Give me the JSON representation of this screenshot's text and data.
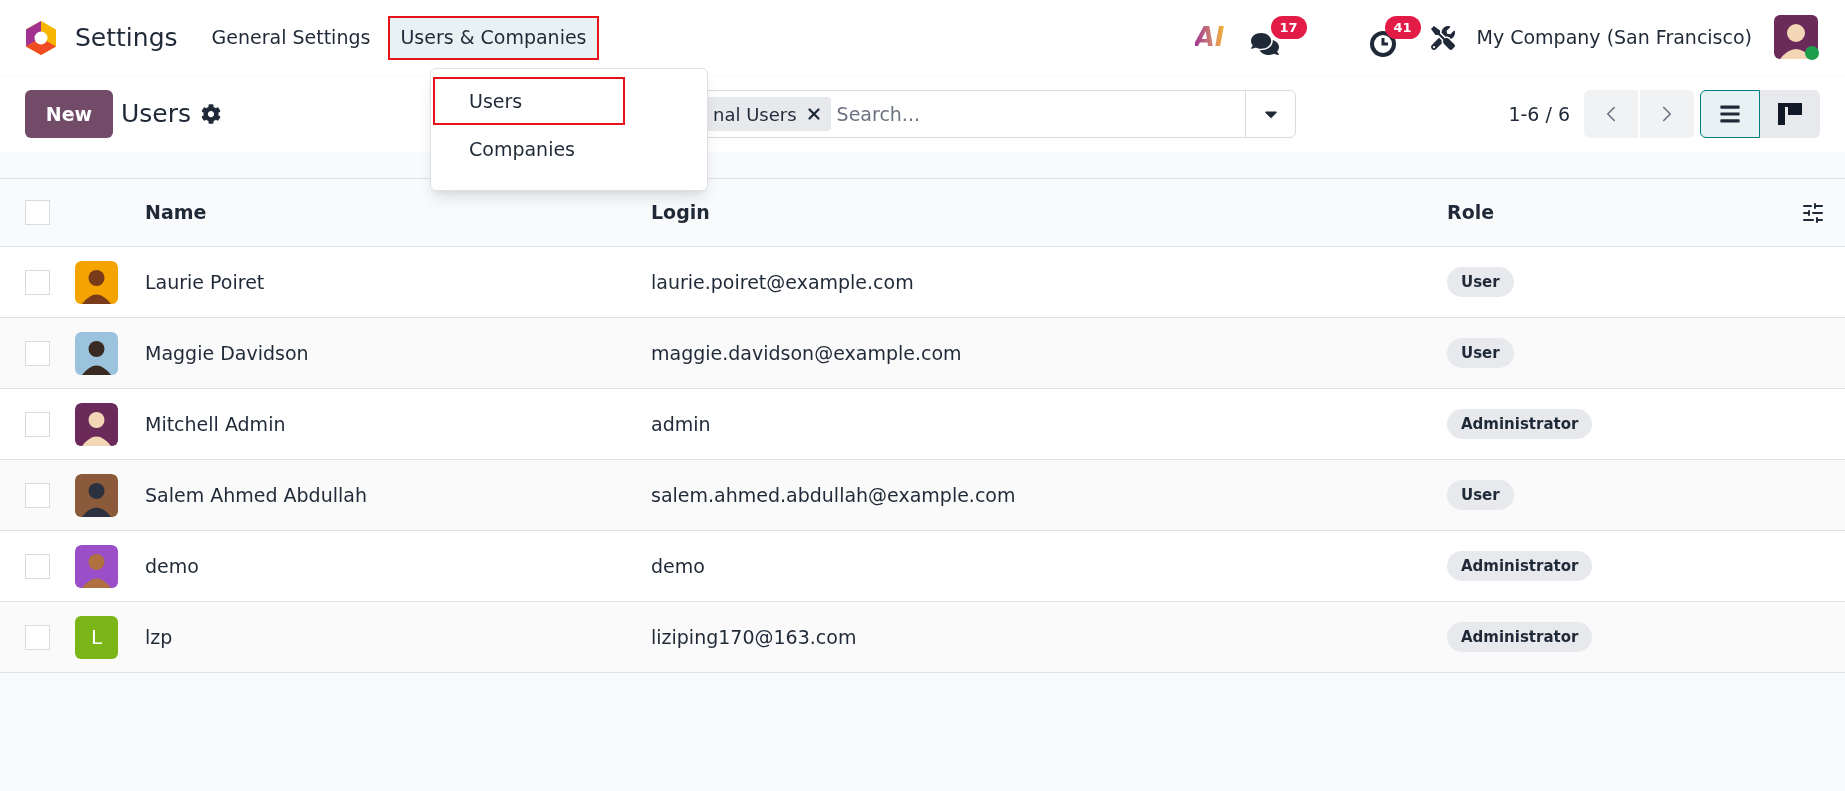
{
  "app": {
    "title": "Settings"
  },
  "menu": [
    {
      "label": "General Settings",
      "selected": false,
      "highlighted": false
    },
    {
      "label": "Users & Companies",
      "selected": true,
      "highlighted": true
    }
  ],
  "dropdown": [
    {
      "label": "Users",
      "highlighted": true
    },
    {
      "label": "Companies",
      "highlighted": false
    }
  ],
  "systray": {
    "ai": "AI",
    "messages_badge": "17",
    "activities_badge": "41",
    "company": "My Company (San Francisco)"
  },
  "control_panel": {
    "new_button": "New",
    "title": "Users",
    "facet": "nal Users",
    "search_placeholder": "Search...",
    "pager": "1-6 / 6",
    "views": [
      {
        "kind": "list",
        "selected": true
      },
      {
        "kind": "kanban",
        "selected": false
      }
    ]
  },
  "table": {
    "select_all_checked": false,
    "columns": [
      "Name",
      "Login",
      "Role"
    ],
    "rows": [
      {
        "name": "Laurie Poiret",
        "login": "laurie.poiret@example.com",
        "role": "User",
        "checked": false
      },
      {
        "name": "Maggie Davidson",
        "login": "maggie.davidson@example.com",
        "role": "User",
        "checked": false
      },
      {
        "name": "Mitchell Admin",
        "login": "admin",
        "role": "Administrator",
        "checked": false
      },
      {
        "name": "Salem Ahmed Abdullah",
        "login": "salem.ahmed.abdullah@example.com",
        "role": "User",
        "checked": false
      },
      {
        "name": "demo",
        "login": "demo",
        "role": "Administrator",
        "checked": false
      },
      {
        "avatar": {
          "kind": "letter",
          "letter": "L",
          "color": "#7cb518"
        },
        "name": "lzp",
        "login": "liziping170@163.com",
        "role": "Administrator",
        "checked": false
      }
    ]
  }
}
